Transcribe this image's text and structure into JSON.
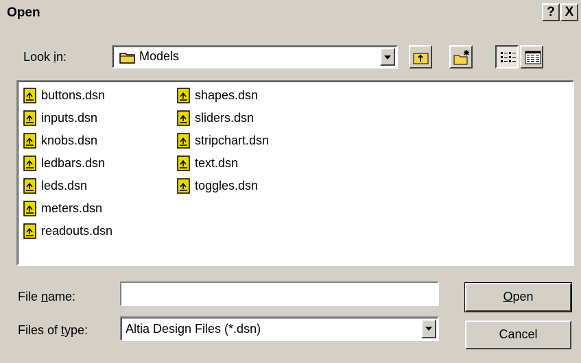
{
  "titlebar": {
    "title": "Open",
    "help": "?",
    "close": "X"
  },
  "look_in": {
    "label_pre": "Look ",
    "label_key": "i",
    "label_post": "n:",
    "value": "Models"
  },
  "toolbar": {
    "up_icon": "up-one-level-icon",
    "new_folder_icon": "new-folder-icon",
    "list_icon": "list-view-icon",
    "details_icon": "details-view-icon"
  },
  "files": {
    "column1": [
      "buttons.dsn",
      "inputs.dsn",
      "knobs.dsn",
      "ledbars.dsn",
      "leds.dsn",
      "meters.dsn",
      "readouts.dsn"
    ],
    "column2": [
      "shapes.dsn",
      "sliders.dsn",
      "stripchart.dsn",
      "text.dsn",
      "toggles.dsn"
    ]
  },
  "file_name": {
    "label_pre": "File ",
    "label_key": "n",
    "label_post": "ame:",
    "value": ""
  },
  "file_type": {
    "label_pre": "Files of ",
    "label_key": "t",
    "label_post": "ype:",
    "value": "Altia Design Files (*.dsn)"
  },
  "buttons": {
    "open_key": "O",
    "open_rest": "pen",
    "cancel": "Cancel"
  },
  "colors": {
    "face": "#d4d0c8",
    "window": "#ffffff",
    "folder": "#f5d34a",
    "file_icon": "#e8d800"
  }
}
